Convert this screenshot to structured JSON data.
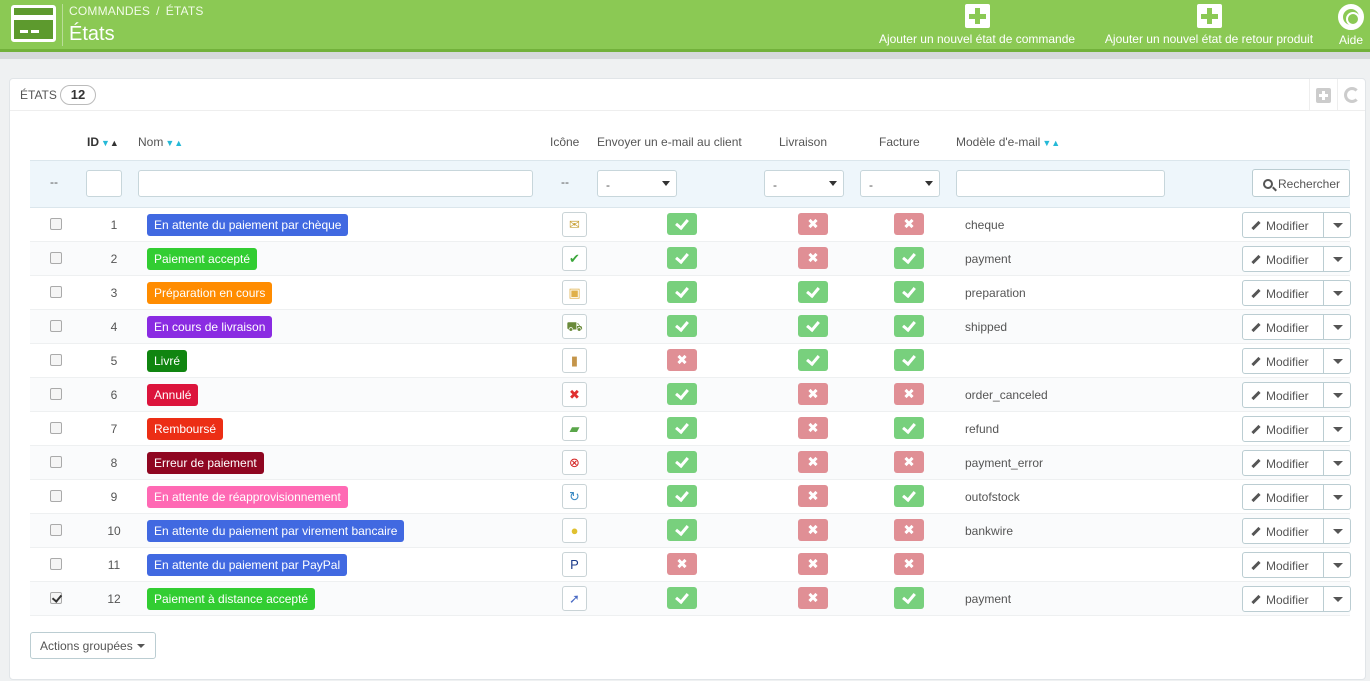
{
  "header": {
    "breadcrumb": [
      "COMMANDES",
      "ÉTATS"
    ],
    "title": "États",
    "buttons": {
      "add_order_state": "Ajouter un nouvel état de commande",
      "add_return_state": "Ajouter un nouvel état de retour produit",
      "help": "Aide"
    },
    "accent": "#8bc954"
  },
  "panel": {
    "title": "ÉTATS",
    "count": "12"
  },
  "table": {
    "headers": {
      "id": "ID",
      "name": "Nom",
      "icon": "Icône",
      "send_email": "Envoyer un e-mail au client",
      "delivery": "Livraison",
      "invoice": "Facture",
      "template": "Modèle d'e-mail"
    },
    "filters": {
      "bulk_placeholder": "--",
      "icon_placeholder": "--",
      "select_value": "-",
      "search_label": "Rechercher"
    },
    "edit_label": "Modifier",
    "rows": [
      {
        "id": "1",
        "name": "En attente du paiement par chèque",
        "color": "#4169E1",
        "icon": "cheque-icon",
        "glyph": "✉",
        "glyph_color": "#c9a23a",
        "send_email": true,
        "delivery": false,
        "invoice": false,
        "template": "cheque",
        "checked": false
      },
      {
        "id": "2",
        "name": "Paiement accepté",
        "color": "#32CD32",
        "icon": "check-mark-icon",
        "glyph": "✔",
        "glyph_color": "#3aa63a",
        "send_email": true,
        "delivery": false,
        "invoice": true,
        "template": "payment",
        "checked": false
      },
      {
        "id": "3",
        "name": "Préparation en cours",
        "color": "#FF8C00",
        "icon": "package-icon",
        "glyph": "▣",
        "glyph_color": "#e0b04a",
        "send_email": true,
        "delivery": true,
        "invoice": true,
        "template": "preparation",
        "checked": false
      },
      {
        "id": "4",
        "name": "En cours de livraison",
        "color": "#8A2BE2",
        "icon": "delivery-truck-icon",
        "glyph": "⛟",
        "glyph_color": "#6a8a3a",
        "send_email": true,
        "delivery": true,
        "invoice": true,
        "template": "shipped",
        "checked": false
      },
      {
        "id": "5",
        "name": "Livré",
        "color": "#108510",
        "icon": "door-icon",
        "glyph": "▮",
        "glyph_color": "#c4954a",
        "send_email": false,
        "delivery": true,
        "invoice": true,
        "template": "",
        "checked": false
      },
      {
        "id": "6",
        "name": "Annulé",
        "color": "#DC143C",
        "icon": "cross-icon",
        "glyph": "✖",
        "glyph_color": "#e03030",
        "send_email": true,
        "delivery": false,
        "invoice": false,
        "template": "order_canceled",
        "checked": false
      },
      {
        "id": "7",
        "name": "Remboursé",
        "color": "#ec2e15",
        "icon": "money-icon",
        "glyph": "▰",
        "glyph_color": "#5aa64a",
        "send_email": true,
        "delivery": false,
        "invoice": true,
        "template": "refund",
        "checked": false
      },
      {
        "id": "8",
        "name": "Erreur de paiement",
        "color": "#8f0621",
        "icon": "error-circle-icon",
        "glyph": "⊗",
        "glyph_color": "#d42020",
        "send_email": true,
        "delivery": false,
        "invoice": false,
        "template": "payment_error",
        "checked": false
      },
      {
        "id": "9",
        "name": "En attente de réapprovisionnement",
        "color": "#FF69B4",
        "icon": "restock-icon",
        "glyph": "↻",
        "glyph_color": "#3a8ac4",
        "send_email": true,
        "delivery": false,
        "invoice": true,
        "template": "outofstock",
        "checked": false
      },
      {
        "id": "10",
        "name": "En attente du paiement par virement bancaire",
        "color": "#4169E1",
        "icon": "coins-icon",
        "glyph": "●",
        "glyph_color": "#e0c030",
        "send_email": true,
        "delivery": false,
        "invoice": false,
        "template": "bankwire",
        "checked": false
      },
      {
        "id": "11",
        "name": "En attente du paiement par PayPal",
        "color": "#4169E1",
        "icon": "paypal-icon",
        "glyph": "P",
        "glyph_color": "#1a3a8a",
        "send_email": false,
        "delivery": false,
        "invoice": false,
        "template": "",
        "checked": false
      },
      {
        "id": "12",
        "name": "Paiement à distance accepté",
        "color": "#32CD32",
        "icon": "remote-payment-icon",
        "glyph": "➚",
        "glyph_color": "#4a6ac4",
        "send_email": true,
        "delivery": false,
        "invoice": true,
        "template": "payment",
        "checked": true
      }
    ]
  },
  "footer": {
    "bulk_actions": "Actions groupées"
  }
}
